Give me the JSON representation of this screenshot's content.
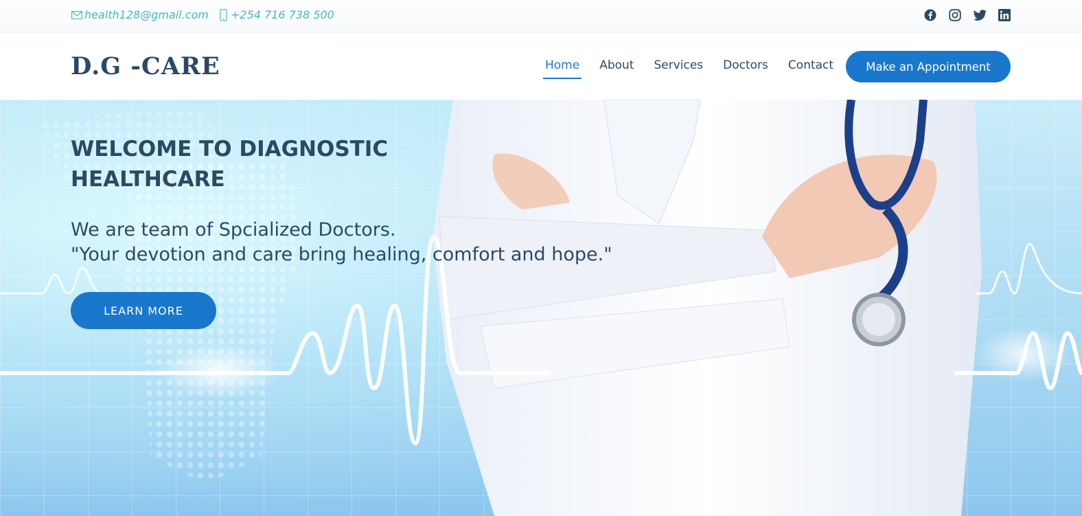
{
  "topbar": {
    "email": "health128@gmail.com",
    "phone": "+254 716 738 500",
    "email_icon": "envelope-icon",
    "phone_icon": "phone-icon",
    "socials": [
      "facebook-icon",
      "instagram-icon",
      "twitter-icon",
      "linkedin-icon"
    ]
  },
  "header": {
    "logo": "D.G -CARE",
    "nav": [
      {
        "label": "Home",
        "active": true
      },
      {
        "label": "About",
        "active": false
      },
      {
        "label": "Services",
        "active": false
      },
      {
        "label": "Doctors",
        "active": false
      },
      {
        "label": "Contact",
        "active": false
      }
    ],
    "appointment_button": "Make an Appointment"
  },
  "hero": {
    "title": "WELCOME TO DIAGNOSTIC HEALTHCARE",
    "subtitle_line1": "We are team of Spcialized Doctors.",
    "subtitle_line2": "\"Your devotion and care bring healing, comfort and hope.\"",
    "button": "LEARN MORE"
  },
  "colors": {
    "primary": "#1977cc",
    "heading": "#2c4964",
    "accent": "#3fbbc0"
  }
}
